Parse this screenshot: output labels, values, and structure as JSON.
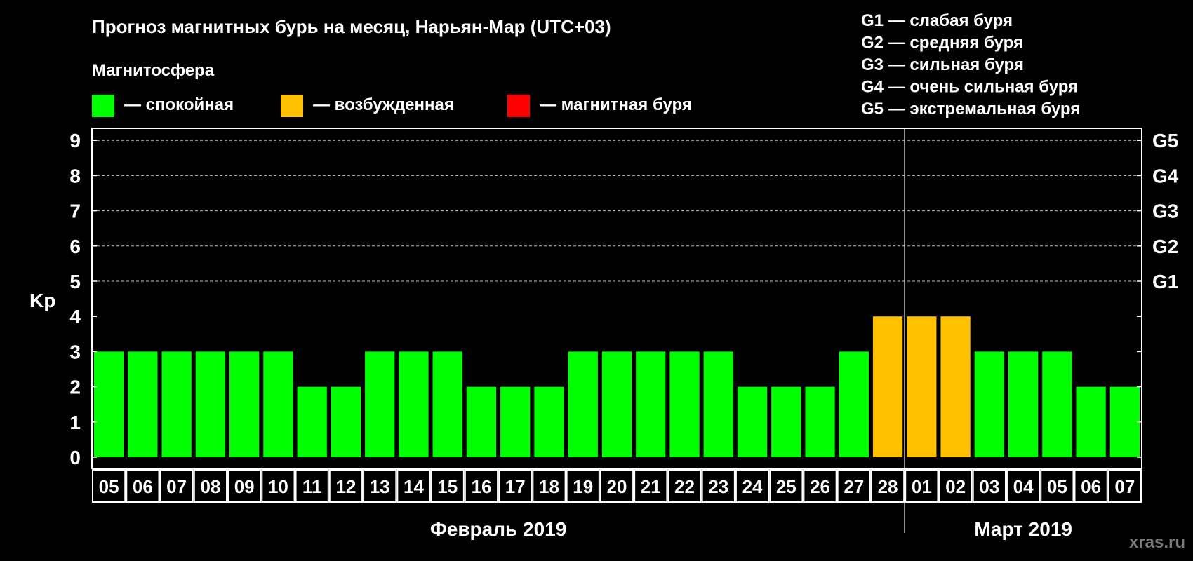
{
  "chart_data": {
    "type": "bar",
    "title": "Прогноз магнитных бурь на месяц, Нарьян-Мар (UTC+03)",
    "ylabel": "Kp",
    "ylim": [
      0,
      9
    ],
    "yticks": [
      "0",
      "1",
      "2",
      "3",
      "4",
      "5",
      "6",
      "7",
      "8",
      "9"
    ],
    "right_axis": [
      {
        "kp": 5,
        "label": "G1"
      },
      {
        "kp": 6,
        "label": "G2"
      },
      {
        "kp": 7,
        "label": "G3"
      },
      {
        "kp": 8,
        "label": "G4"
      },
      {
        "kp": 9,
        "label": "G5"
      }
    ],
    "grid": "dashed horizontal at Kp 5–9",
    "legend": {
      "title": "Магнитосфера",
      "items": [
        {
          "label": "— спокойная",
          "color": "#00ff00"
        },
        {
          "label": "— возбужденная",
          "color": "#ffc000"
        },
        {
          "label": "— магнитная буря",
          "color": "#ff0000"
        }
      ]
    },
    "storm_scale": [
      "G1 — слабая буря",
      "G2 — средняя буря",
      "G3 — сильная буря",
      "G4 — очень сильная буря",
      "G5 — экстремальная буря"
    ],
    "months": [
      {
        "label": "Февраль 2019",
        "start": 0,
        "count": 24
      },
      {
        "label": "Март 2019",
        "start": 24,
        "count": 7
      }
    ],
    "categories": [
      "05",
      "06",
      "07",
      "08",
      "09",
      "10",
      "11",
      "12",
      "13",
      "14",
      "15",
      "16",
      "17",
      "18",
      "19",
      "20",
      "21",
      "22",
      "23",
      "24",
      "25",
      "26",
      "27",
      "28",
      "01",
      "02",
      "03",
      "04",
      "05",
      "06",
      "07"
    ],
    "values": [
      3,
      3,
      3,
      3,
      3,
      3,
      2,
      2,
      3,
      3,
      3,
      2,
      2,
      2,
      3,
      3,
      3,
      3,
      3,
      2,
      2,
      2,
      3,
      4,
      4,
      4,
      3,
      3,
      3,
      2,
      2
    ],
    "colors": {
      "quiet": "#00ff00",
      "active": "#ffc000",
      "storm": "#ff0000"
    },
    "watermark": "xras.ru"
  }
}
